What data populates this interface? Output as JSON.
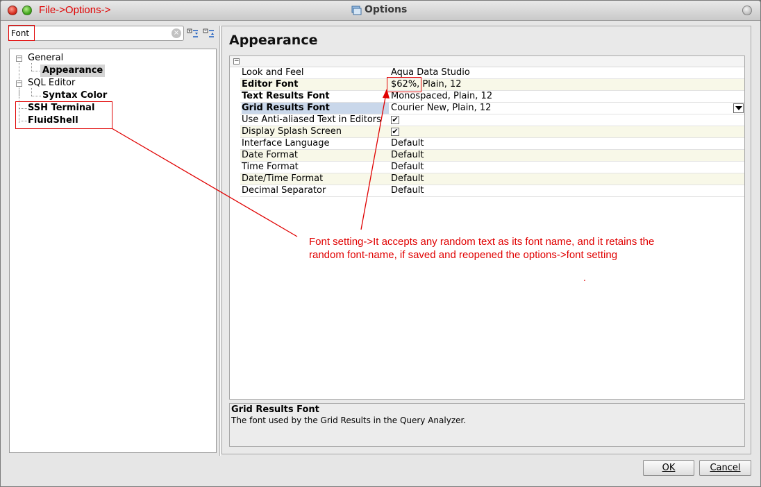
{
  "window": {
    "title": "Options",
    "annotation_top": "File->Options->"
  },
  "search": {
    "value": "Font"
  },
  "tree": {
    "items": [
      {
        "label": "General"
      },
      {
        "label": "Appearance"
      },
      {
        "label": "SQL Editor"
      },
      {
        "label": "Syntax Color"
      },
      {
        "label": "SSH Terminal"
      },
      {
        "label": "FluidShell"
      }
    ]
  },
  "main": {
    "title": "Appearance",
    "properties": [
      {
        "name": "Look and Feel",
        "value": "Aqua Data Studio"
      },
      {
        "name": "Editor Font",
        "value_highlight": "$62%,",
        "value": " Plain, 12"
      },
      {
        "name": "Text Results Font",
        "value": "Monospaced, Plain, 12"
      },
      {
        "name": "Grid Results Font",
        "value": "Courier New, Plain, 12"
      },
      {
        "name": "Use Anti-aliased Text in Editors",
        "checked": true
      },
      {
        "name": "Display Splash Screen",
        "checked": true
      },
      {
        "name": "Interface Language",
        "value": "Default"
      },
      {
        "name": "Date Format",
        "value": "Default"
      },
      {
        "name": "Time Format",
        "value": "Default"
      },
      {
        "name": "Date/Time Format",
        "value": "Default"
      },
      {
        "name": "Decimal Separator",
        "value": "Default"
      }
    ],
    "description": {
      "title": "Grid Results Font",
      "text": "The font used by the Grid Results in the Query Analyzer."
    }
  },
  "buttons": {
    "ok": "OK",
    "cancel": "Cancel"
  },
  "annotation": {
    "line1": "Font setting->It accepts any random text as its font name, and it retains the",
    "line2": "random font-name, if saved and reopened the options->font setting",
    "dot": "."
  },
  "colors": {
    "annotation_red": "#e00000",
    "selected_row": "#c9d7ea",
    "alt_row": "#f8f8e8"
  }
}
